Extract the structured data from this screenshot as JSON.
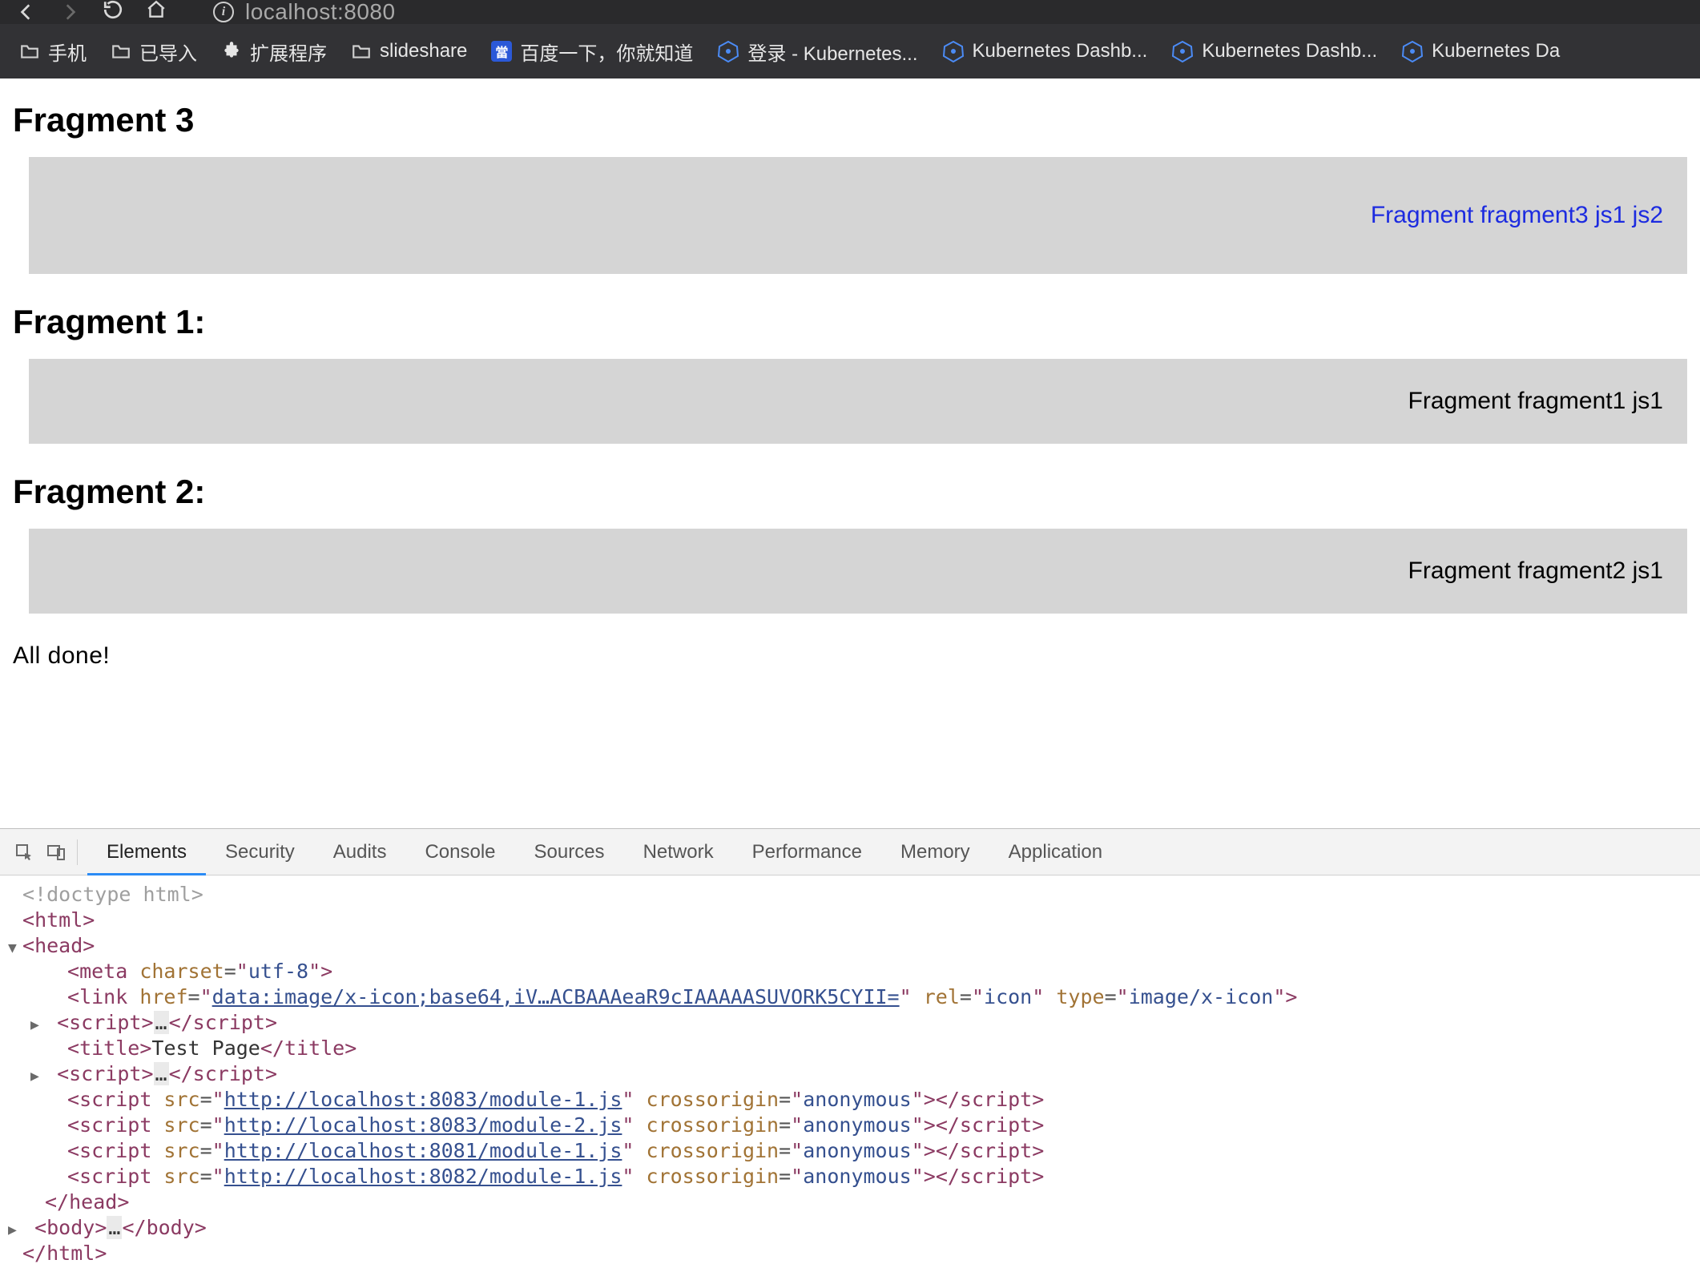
{
  "browser": {
    "url": "localhost:8080"
  },
  "bookmarks": [
    {
      "icon": "folder",
      "label": "手机"
    },
    {
      "icon": "folder",
      "label": "已导入"
    },
    {
      "icon": "puzzle",
      "label": "扩展程序"
    },
    {
      "icon": "folder",
      "label": "slideshare"
    },
    {
      "icon": "baidu",
      "label": "百度一下，你就知道"
    },
    {
      "icon": "k8s",
      "label": "登录 - Kubernetes..."
    },
    {
      "icon": "k8s",
      "label": "Kubernetes Dashb..."
    },
    {
      "icon": "k8s",
      "label": "Kubernetes Dashb..."
    },
    {
      "icon": "k8s",
      "label": "Kubernetes Da"
    }
  ],
  "page": {
    "sections": [
      {
        "heading": "Fragment 3",
        "text": "Fragment fragment3 js1 js2",
        "color": "blue",
        "big": true
      },
      {
        "heading": "Fragment 1:",
        "text": "Fragment fragment1 js1",
        "color": "black"
      },
      {
        "heading": "Fragment 2:",
        "text": "Fragment fragment2 js1",
        "color": "black"
      }
    ],
    "footer": "All done!"
  },
  "devtools": {
    "tabs": [
      "Elements",
      "Security",
      "Audits",
      "Console",
      "Sources",
      "Network",
      "Performance",
      "Memory",
      "Application"
    ],
    "activeTab": "Elements",
    "code": {
      "doctype": "<!doctype html>",
      "meta_charset": "utf-8",
      "link_href": "data:image/x-icon;base64,iV…ACBAAAeaR9cIAAAAASUVORK5CYII=",
      "link_rel": "icon",
      "link_type": "image/x-icon",
      "title": "Test Page",
      "scripts": [
        {
          "src": "http://localhost:8083/module-1.js",
          "crossorigin": "anonymous"
        },
        {
          "src": "http://localhost:8083/module-2.js",
          "crossorigin": "anonymous"
        },
        {
          "src": "http://localhost:8081/module-1.js",
          "crossorigin": "anonymous"
        },
        {
          "src": "http://localhost:8082/module-1.js",
          "crossorigin": "anonymous"
        }
      ]
    }
  }
}
